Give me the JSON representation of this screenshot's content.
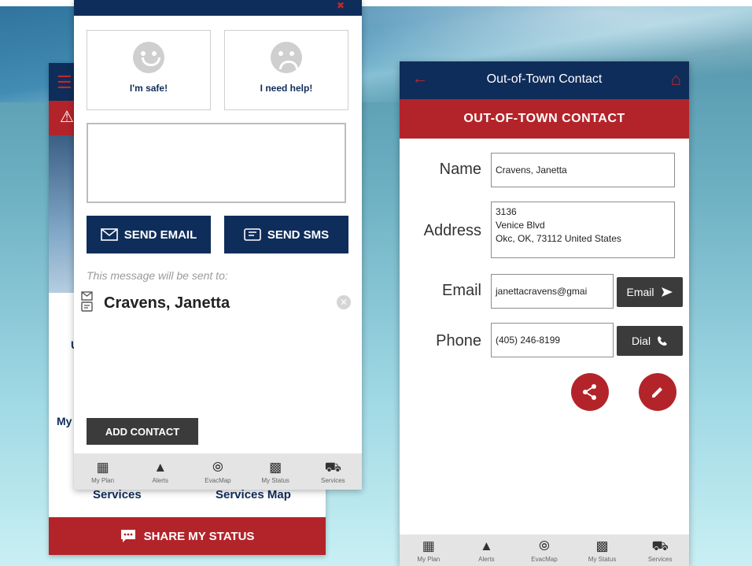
{
  "back_screen": {
    "side_letter": "U",
    "side_my": "My",
    "link_services": "Services",
    "link_services_map": "Services Map",
    "share_button": "SHARE MY STATUS"
  },
  "status_panel": {
    "safe_label": "I'm safe!",
    "help_label": "I need help!",
    "message_value": "",
    "send_email": "SEND EMAIL",
    "send_sms": "SEND SMS",
    "hint": "This message will be sent to:",
    "recipient": "Cravens, Janetta",
    "add_contact": "ADD CONTACT"
  },
  "nav": [
    {
      "label": "My Plan",
      "icon": "plan-icon"
    },
    {
      "label": "Alerts",
      "icon": "alert-icon"
    },
    {
      "label": "EvacMap",
      "icon": "compass-icon"
    },
    {
      "label": "My Status",
      "icon": "chat-icon"
    },
    {
      "label": "Services",
      "icon": "truck-icon"
    }
  ],
  "contact": {
    "header_title": "Out-of-Town Contact",
    "band_title": "OUT-OF-TOWN CONTACT",
    "name_label": "Name",
    "name_value": "Cravens, Janetta",
    "address_label": "Address",
    "address_lines": [
      "3136",
      "Venice Blvd",
      "Okc, OK, 73112 United States"
    ],
    "email_label": "Email",
    "email_value": "janettacravens@gmai",
    "email_button": "Email",
    "phone_label": "Phone",
    "phone_value": "(405) 246-8199",
    "dial_button": "Dial"
  },
  "colors": {
    "navy": "#0f2d5a",
    "red": "#b3242a",
    "dark_button": "#3b3b3b"
  }
}
